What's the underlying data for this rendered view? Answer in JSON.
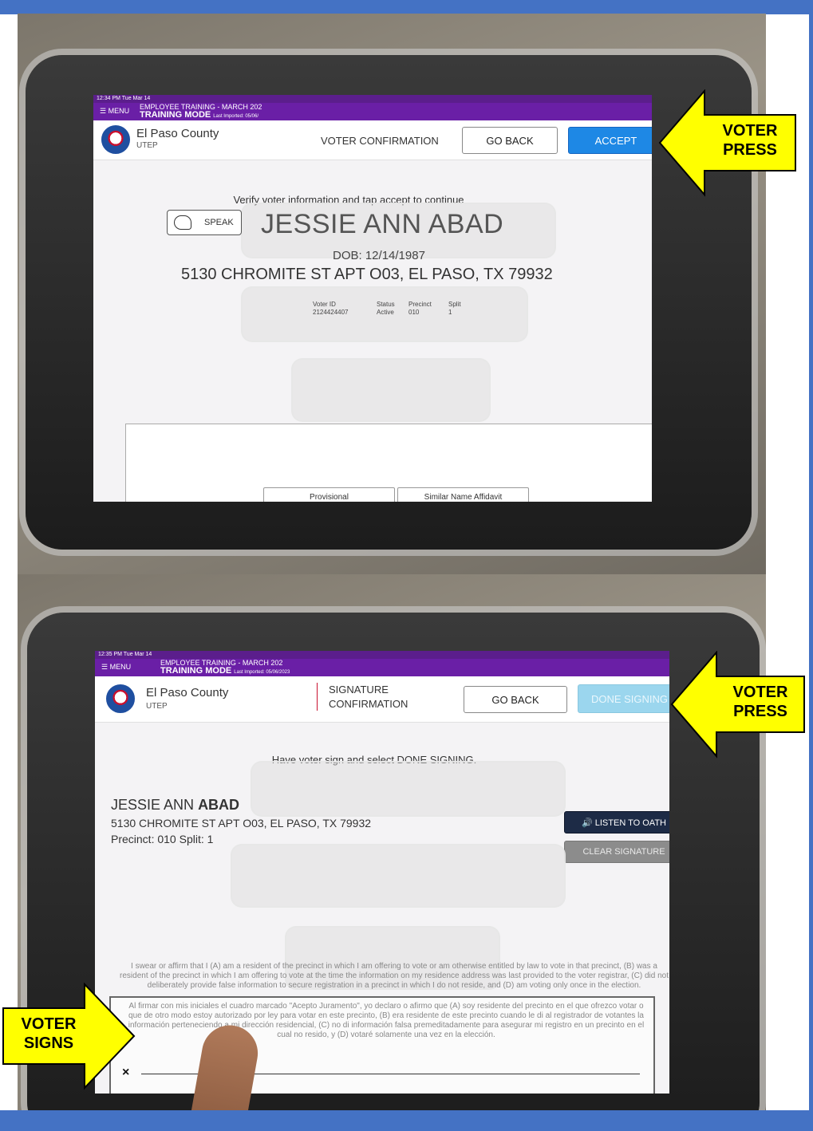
{
  "screen1": {
    "status_time": "12:34 PM  Tue Mar 14",
    "menu_label": "MENU",
    "training_title": "EMPLOYEE TRAINING - MARCH 202",
    "training_mode": "TRAINING MODE",
    "last_imported": "Last Imported: 05/06/",
    "county": "El Paso County",
    "location": "UTEP",
    "screen_title": "VOTER CONFIRMATION",
    "go_back": "GO BACK",
    "accept": "ACCEPT",
    "instruction": "Verify voter information and tap accept to continue",
    "speak": "SPEAK",
    "voter_name": "JESSIE ANN ABAD",
    "dob": "DOB: 12/14/1987",
    "address": "5130 CHROMITE ST APT O03, EL PASO, TX 79932",
    "voter_id_label": "Voter ID",
    "voter_id": "2124424407",
    "status_label": "Status",
    "status": "Active",
    "precinct_label": "Precinct",
    "precinct": "010",
    "split_label": "Split",
    "split": "1",
    "provisional": "Provisional",
    "similar_name": "Similar Name Affidavit"
  },
  "screen2": {
    "status_time": "12:35 PM  Tue Mar 14",
    "menu_label": "MENU",
    "training_title": "EMPLOYEE TRAINING - MARCH 202",
    "training_mode": "TRAINING MODE",
    "last_imported": "Last Imported: 05/06/2023",
    "county": "El Paso County",
    "location": "UTEP",
    "screen_title_line1": "SIGNATURE",
    "screen_title_line2": "CONFIRMATION",
    "go_back": "GO BACK",
    "done_signing": "DONE SIGNING",
    "instruction": "Have voter sign and select DONE SIGNING.",
    "voter_first": "JESSIE ANN",
    "voter_last": "ABAD",
    "address": "5130 CHROMITE ST APT O03, EL PASO, TX 79932",
    "precinct_split": "Precinct: 010 Split: 1",
    "listen_oath": "LISTEN TO OATH",
    "clear_signature": "CLEAR SIGNATURE",
    "oath_en": "I swear or affirm that I (A) am a resident of the precinct in which I am offering to vote or am otherwise entitled by law to vote in that precinct, (B) was a resident of the precinct in which I am offering to vote at the time the information on my residence address was last provided to the voter registrar, (C) did not deliberately provide false information to secure registration in a precinct in which I do not reside, and (D) am voting only once in the election.",
    "oath_es": "Al firmar con mis iniciales el cuadro marcado \"Acepto Juramento\", yo declaro o afirmo que (A) soy residente del precinto en el que ofrezco votar o que de otro modo estoy autorizado por ley para votar en este precinto, (B) era residente de este precinto cuando le di al registrador de votantes la información perteneciendo a mi dirección residencial, (C) no di información falsa premeditadamente para asegurar mi registro en un precinto en el cual no resido, y (D) votaré solamente una vez en la elección.",
    "sign_x": "×"
  },
  "callouts": {
    "voter_press_1": "VOTER PRESS",
    "voter_press_2": "VOTER PRESS",
    "voter_signs": "VOTER SIGNS"
  },
  "colors": {
    "frame_blue": "#4472c4",
    "purple_bar": "#6a1fa6",
    "accept_blue": "#1e88e5",
    "callout_yellow": "#ffff00"
  }
}
